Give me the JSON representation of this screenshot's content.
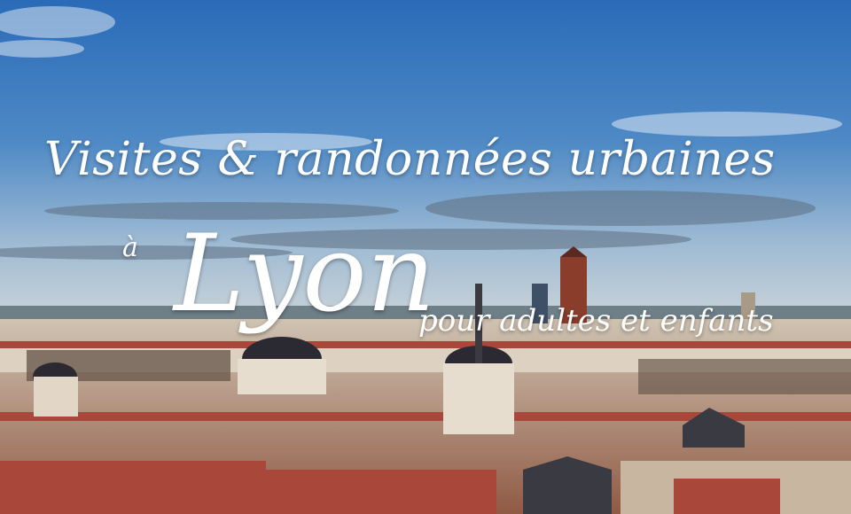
{
  "headline": {
    "line1": "Visites & randonnées urbaines",
    "preposition": "à",
    "city": "Lyon",
    "audience": "pour adultes et enfants"
  },
  "colors": {
    "sky_top": "#2a6bb8",
    "sky_bottom": "#a9c3d8",
    "roofs": "#b85a3a",
    "buildings": "#d8cfc0",
    "text": "#ffffff"
  }
}
